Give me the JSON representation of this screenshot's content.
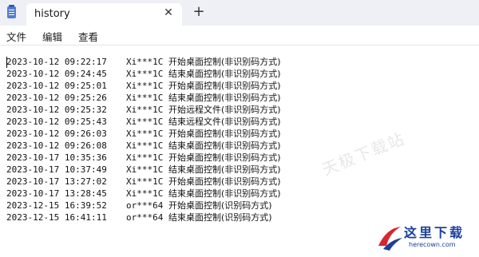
{
  "window": {
    "tab_title": "history",
    "close_glyph": "✕",
    "new_tab_glyph": "+"
  },
  "menu": {
    "items": [
      "文件",
      "编辑",
      "查看"
    ]
  },
  "log": [
    {
      "time": "2023-10-12 09:22:17",
      "user": "Xi***1C",
      "action": "开始桌面控制(非识别码方式)"
    },
    {
      "time": "2023-10-12 09:24:45",
      "user": "Xi***1C",
      "action": "结束桌面控制(非识别码方式)"
    },
    {
      "time": "2023-10-12 09:25:01",
      "user": "Xi***1C",
      "action": "开始桌面控制(非识别码方式)"
    },
    {
      "time": "2023-10-12 09:25:26",
      "user": "Xi***1C",
      "action": "结束桌面控制(非识别码方式)"
    },
    {
      "time": "2023-10-12 09:25:32",
      "user": "Xi***1C",
      "action": "开始远程文件(非识别码方式)"
    },
    {
      "time": "2023-10-12 09:25:43",
      "user": "Xi***1C",
      "action": "结束远程文件(非识别码方式)"
    },
    {
      "time": "2023-10-12 09:26:03",
      "user": "Xi***1C",
      "action": "开始桌面控制(非识别码方式)"
    },
    {
      "time": "2023-10-12 09:26:08",
      "user": "Xi***1C",
      "action": "结束桌面控制(非识别码方式)"
    },
    {
      "time": "2023-10-17 10:35:36",
      "user": "Xi***1C",
      "action": "开始桌面控制(非识别码方式)"
    },
    {
      "time": "2023-10-17 10:37:49",
      "user": "Xi***1C",
      "action": "结束桌面控制(非识别码方式)"
    },
    {
      "time": "2023-10-17 13:27:02",
      "user": "Xi***1C",
      "action": "开始桌面控制(非识别码方式)"
    },
    {
      "time": "2023-10-17 13:28:45",
      "user": "Xi***1C",
      "action": "结束桌面控制(非识别码方式)"
    },
    {
      "time": "2023-12-15 16:39:52",
      "user": "or***64",
      "action": "开始桌面控制(识别码方式)"
    },
    {
      "time": "2023-12-15 16:41:11",
      "user": "or***64",
      "action": "结束桌面控制(识别码方式)"
    }
  ],
  "watermark": {
    "site_name": "天极下载站",
    "logo_text": "这里下载",
    "logo_url": "herecown.com"
  }
}
